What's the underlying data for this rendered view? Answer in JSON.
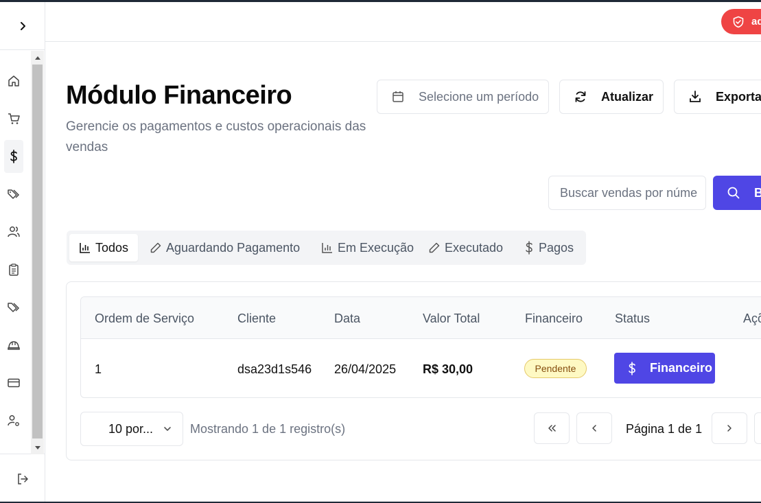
{
  "header": {
    "admin_badge": "ad"
  },
  "page": {
    "title": "Módulo Financeiro",
    "subtitle": "Gerencie os pagamentos e custos operacionais das vendas"
  },
  "toolbar": {
    "period_placeholder": "Selecione um período",
    "refresh_label": "Atualizar",
    "export_label": "Exportar"
  },
  "search": {
    "placeholder": "Buscar vendas por número",
    "button_label": "B"
  },
  "tabs": [
    {
      "label": "Todos",
      "icon": "bar-chart-icon",
      "active": true
    },
    {
      "label": "Aguardando Pagamento",
      "icon": "pencil-icon"
    },
    {
      "label": "Em Execução",
      "icon": "bar-chart-icon"
    },
    {
      "label": "Executado",
      "icon": "pencil-icon"
    },
    {
      "label": "Pagos",
      "icon": "dollar-icon"
    }
  ],
  "table": {
    "columns": [
      "Ordem de Serviço",
      "Cliente",
      "Data",
      "Valor Total",
      "Financeiro",
      "Status",
      "Açõ"
    ],
    "rows": [
      {
        "order": "1",
        "client": "dsa23d1s546",
        "date": "26/04/2025",
        "total": "R$ 30,00",
        "financial_status": "Pendente",
        "action_label": "Financeiro"
      }
    ]
  },
  "pagination": {
    "per_page": "10 por...",
    "records": "Mostrando 1 de 1 registro(s)",
    "page_label": "Página 1 de 1"
  },
  "colors": {
    "primary": "#4f46e5",
    "danger": "#ef4444",
    "pending_bg": "#fef9c3"
  }
}
